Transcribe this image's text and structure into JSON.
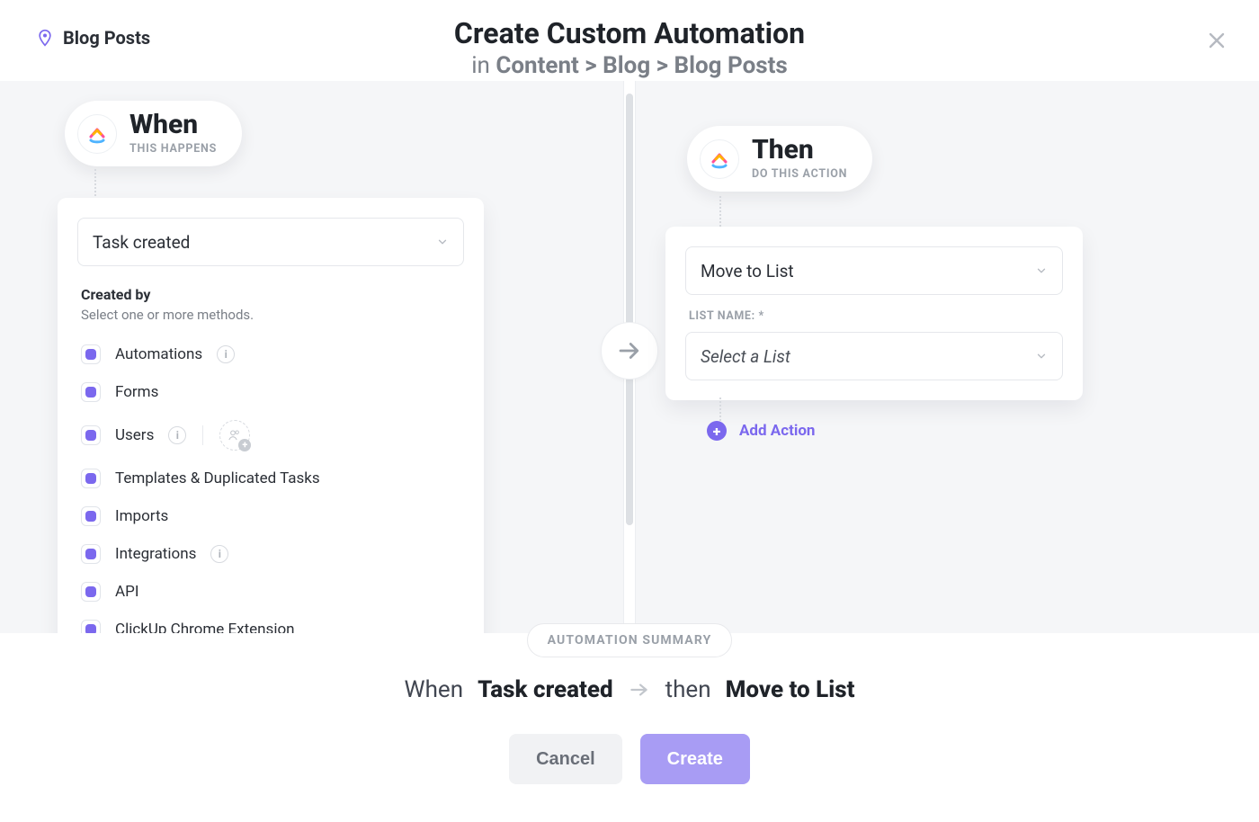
{
  "header": {
    "breadcrumb_label": "Blog Posts",
    "title": "Create Custom Automation",
    "subtitle_prefix": "in ",
    "breadcrumb_path": "Content > Blog > Blog Posts"
  },
  "when": {
    "pill_title": "When",
    "pill_subtitle": "THIS HAPPENS",
    "trigger_selected": "Task created",
    "created_by_title": "Created by",
    "created_by_subtitle": "Select one or more methods.",
    "methods": [
      {
        "label": "Automations",
        "has_info": true,
        "has_users_badge": false
      },
      {
        "label": "Forms",
        "has_info": false,
        "has_users_badge": false
      },
      {
        "label": "Users",
        "has_info": true,
        "has_users_badge": true
      },
      {
        "label": "Templates & Duplicated Tasks",
        "has_info": false,
        "has_users_badge": false
      },
      {
        "label": "Imports",
        "has_info": false,
        "has_users_badge": false
      },
      {
        "label": "Integrations",
        "has_info": true,
        "has_users_badge": false
      },
      {
        "label": "API",
        "has_info": false,
        "has_users_badge": false
      },
      {
        "label": "ClickUp Chrome Extension",
        "has_info": false,
        "has_users_badge": false
      }
    ]
  },
  "then": {
    "pill_title": "Then",
    "pill_subtitle": "DO THIS ACTION",
    "action_selected": "Move to List",
    "list_label": "LIST NAME: *",
    "list_placeholder": "Select a List",
    "add_action_label": "Add Action"
  },
  "footer": {
    "chip": "AUTOMATION SUMMARY",
    "when_word": "When",
    "when_value": "Task created",
    "then_word": "then",
    "then_value": "Move to List",
    "cancel": "Cancel",
    "create": "Create"
  }
}
